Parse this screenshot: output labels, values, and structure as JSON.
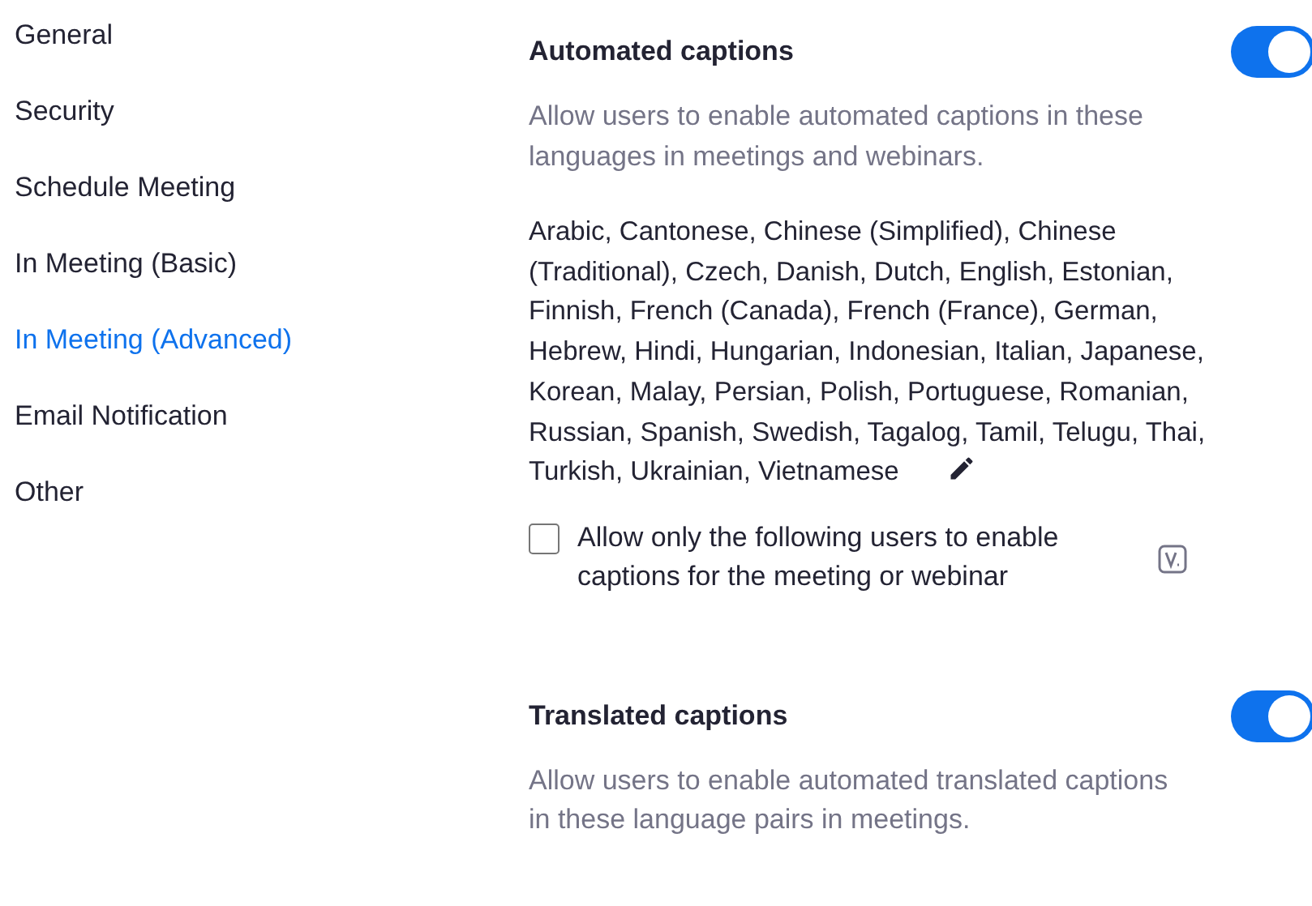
{
  "sidebar": {
    "items": [
      {
        "label": "General",
        "selected": false
      },
      {
        "label": "Security",
        "selected": false
      },
      {
        "label": "Schedule Meeting",
        "selected": false
      },
      {
        "label": "In Meeting (Basic)",
        "selected": false
      },
      {
        "label": "In Meeting (Advanced)",
        "selected": true
      },
      {
        "label": "Email Notification",
        "selected": false
      },
      {
        "label": "Other",
        "selected": false
      }
    ]
  },
  "settings": [
    {
      "title": "Automated captions",
      "on": true,
      "description": "Allow users to enable automated captions in these languages in meetings and webinars.",
      "languages": "Arabic,  Cantonese,  Chinese (Simplified),  Chinese (Traditional),  Czech,  Danish,  Dutch,  English,  Estonian,  Finnish,  French (Canada),  French (France),  German,  Hebrew,  Hindi,  Hungarian,  Indonesian,  Italian,  Japanese,  Korean,  Malay,  Persian,  Polish,  Portuguese,  Romanian,  Russian,  Spanish,  Swedish,  Tagalog,  Tamil,  Telugu,  Thai,  Turkish,  Ukrainian,  Vietnamese",
      "option": {
        "label": "Allow only the following users to enable captions for the meeting or webinar",
        "checked": false
      }
    },
    {
      "title": "Translated captions",
      "on": true,
      "description": "Allow users to enable automated translated captions in these language pairs in meetings."
    }
  ]
}
